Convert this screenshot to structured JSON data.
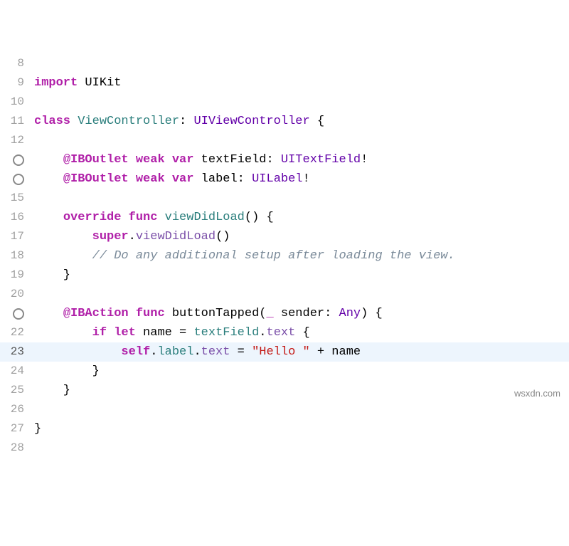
{
  "watermark": "wsxdn.com",
  "lines": [
    {
      "num": "8",
      "bp": false,
      "hl": false,
      "tokens": []
    },
    {
      "num": "9",
      "bp": false,
      "hl": false,
      "tokens": [
        {
          "cls": "kw-import",
          "t": "import"
        },
        {
          "cls": "text",
          "t": " UIKit"
        }
      ]
    },
    {
      "num": "10",
      "bp": false,
      "hl": false,
      "tokens": []
    },
    {
      "num": "11",
      "bp": false,
      "hl": false,
      "tokens": [
        {
          "cls": "kw-class",
          "t": "class"
        },
        {
          "cls": "text",
          "t": " "
        },
        {
          "cls": "ident-teal",
          "t": "ViewController"
        },
        {
          "cls": "text",
          "t": ": "
        },
        {
          "cls": "typeExt",
          "t": "UIViewController"
        },
        {
          "cls": "text",
          "t": " {"
        }
      ]
    },
    {
      "num": "12",
      "bp": false,
      "hl": false,
      "tokens": []
    },
    {
      "num": "",
      "bp": true,
      "hl": false,
      "tokens": [
        {
          "cls": "text",
          "t": "    "
        },
        {
          "cls": "attr",
          "t": "@IBOutlet"
        },
        {
          "cls": "text",
          "t": " "
        },
        {
          "cls": "kw-weak",
          "t": "weak"
        },
        {
          "cls": "text",
          "t": " "
        },
        {
          "cls": "kw-var",
          "t": "var"
        },
        {
          "cls": "text",
          "t": " textField: "
        },
        {
          "cls": "typeExt",
          "t": "UITextField"
        },
        {
          "cls": "text",
          "t": "!"
        }
      ]
    },
    {
      "num": "",
      "bp": true,
      "hl": false,
      "tokens": [
        {
          "cls": "text",
          "t": "    "
        },
        {
          "cls": "attr",
          "t": "@IBOutlet"
        },
        {
          "cls": "text",
          "t": " "
        },
        {
          "cls": "kw-weak",
          "t": "weak"
        },
        {
          "cls": "text",
          "t": " "
        },
        {
          "cls": "kw-var",
          "t": "var"
        },
        {
          "cls": "text",
          "t": " label: "
        },
        {
          "cls": "typeExt",
          "t": "UILabel"
        },
        {
          "cls": "text",
          "t": "!"
        }
      ]
    },
    {
      "num": "15",
      "bp": false,
      "hl": false,
      "tokens": []
    },
    {
      "num": "16",
      "bp": false,
      "hl": false,
      "tokens": [
        {
          "cls": "text",
          "t": "    "
        },
        {
          "cls": "kw-override",
          "t": "override"
        },
        {
          "cls": "text",
          "t": " "
        },
        {
          "cls": "kw-func",
          "t": "func"
        },
        {
          "cls": "text",
          "t": " "
        },
        {
          "cls": "ident-teal",
          "t": "viewDidLoad"
        },
        {
          "cls": "text",
          "t": "() {"
        }
      ]
    },
    {
      "num": "17",
      "bp": false,
      "hl": false,
      "tokens": [
        {
          "cls": "text",
          "t": "        "
        },
        {
          "cls": "kw-super",
          "t": "super"
        },
        {
          "cls": "text",
          "t": "."
        },
        {
          "cls": "ident-purple",
          "t": "viewDidLoad"
        },
        {
          "cls": "text",
          "t": "()"
        }
      ]
    },
    {
      "num": "18",
      "bp": false,
      "hl": false,
      "tokens": [
        {
          "cls": "text",
          "t": "        "
        },
        {
          "cls": "comment",
          "t": "// Do any additional setup after loading the view."
        }
      ]
    },
    {
      "num": "19",
      "bp": false,
      "hl": false,
      "tokens": [
        {
          "cls": "text",
          "t": "    }"
        }
      ]
    },
    {
      "num": "20",
      "bp": false,
      "hl": false,
      "tokens": []
    },
    {
      "num": "",
      "bp": true,
      "hl": false,
      "tokens": [
        {
          "cls": "text",
          "t": "    "
        },
        {
          "cls": "attr",
          "t": "@IBAction"
        },
        {
          "cls": "text",
          "t": " "
        },
        {
          "cls": "kw-func",
          "t": "func"
        },
        {
          "cls": "text",
          "t": " buttonTapped("
        },
        {
          "cls": "kw-weak",
          "t": "_"
        },
        {
          "cls": "text",
          "t": " sender: "
        },
        {
          "cls": "typeExt",
          "t": "Any"
        },
        {
          "cls": "text",
          "t": ") {"
        }
      ]
    },
    {
      "num": "22",
      "bp": false,
      "hl": false,
      "tokens": [
        {
          "cls": "text",
          "t": "        "
        },
        {
          "cls": "kw-if",
          "t": "if"
        },
        {
          "cls": "text",
          "t": " "
        },
        {
          "cls": "kw-let",
          "t": "let"
        },
        {
          "cls": "text",
          "t": " name = "
        },
        {
          "cls": "ident-teal",
          "t": "textField"
        },
        {
          "cls": "text",
          "t": "."
        },
        {
          "cls": "ident-purple",
          "t": "text"
        },
        {
          "cls": "text",
          "t": " {"
        }
      ]
    },
    {
      "num": "23",
      "bp": false,
      "hl": true,
      "current": true,
      "tokens": [
        {
          "cls": "text",
          "t": "            "
        },
        {
          "cls": "kw-self",
          "t": "self"
        },
        {
          "cls": "text",
          "t": "."
        },
        {
          "cls": "ident-teal",
          "t": "label"
        },
        {
          "cls": "text",
          "t": "."
        },
        {
          "cls": "ident-purple",
          "t": "text"
        },
        {
          "cls": "text",
          "t": " = "
        },
        {
          "cls": "string",
          "t": "\"Hello \""
        },
        {
          "cls": "text",
          "t": " + name"
        }
      ]
    },
    {
      "num": "24",
      "bp": false,
      "hl": false,
      "tokens": [
        {
          "cls": "text",
          "t": "        }"
        }
      ]
    },
    {
      "num": "25",
      "bp": false,
      "hl": false,
      "tokens": [
        {
          "cls": "text",
          "t": "    }"
        }
      ]
    },
    {
      "num": "26",
      "bp": false,
      "hl": false,
      "tokens": []
    },
    {
      "num": "27",
      "bp": false,
      "hl": false,
      "tokens": [
        {
          "cls": "text",
          "t": "}"
        }
      ]
    },
    {
      "num": "28",
      "bp": false,
      "hl": false,
      "tokens": []
    }
  ]
}
